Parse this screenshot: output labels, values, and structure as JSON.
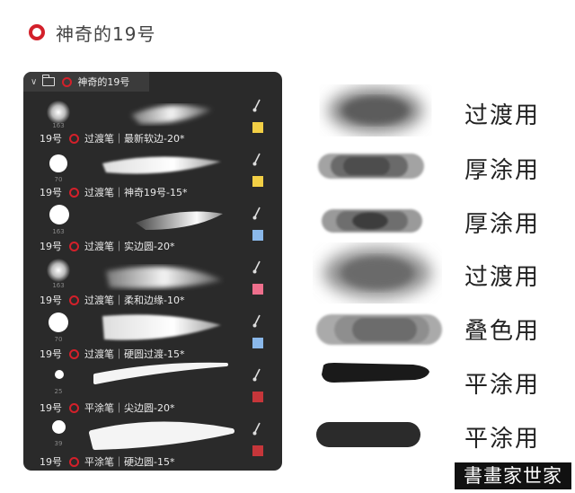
{
  "header": {
    "title": "神奇的19号"
  },
  "panel": {
    "group_name": "神奇的19号",
    "brushes": [
      {
        "size": "163",
        "tip": "soft",
        "number": "19号",
        "name": "过渡笔｜最新软边-20*",
        "swatch": "#f2cf45"
      },
      {
        "size": "70",
        "tip": "hard",
        "number": "19号",
        "name": "过渡笔｜神奇19号-15*",
        "swatch": "#f2cf45"
      },
      {
        "size": "163",
        "tip": "hard",
        "number": "19号",
        "name": "过渡笔｜实边圆-20*",
        "swatch": "#8ab8ea"
      },
      {
        "size": "163",
        "tip": "soft",
        "number": "19号",
        "name": "过渡笔｜柔和边缘-10*",
        "swatch": "#ee6f8c"
      },
      {
        "size": "70",
        "tip": "hard",
        "number": "19号",
        "name": "过渡笔｜硬圆过渡-15*",
        "swatch": "#8ab8ea"
      },
      {
        "size": "25",
        "tip": "hard",
        "number": "19号",
        "name": "平涂笔｜尖边圆-20*",
        "swatch": "#c6363a"
      },
      {
        "size": "39",
        "tip": "hard",
        "number": "19号",
        "name": "平涂笔｜硬边圆-15*",
        "swatch": "#c6363a"
      }
    ]
  },
  "samples": [
    {
      "label": "过渡用"
    },
    {
      "label": "厚涂用"
    },
    {
      "label": "厚涂用"
    },
    {
      "label": "过渡用"
    },
    {
      "label": "叠色用"
    },
    {
      "label": "平涂用"
    },
    {
      "label": "平涂用"
    }
  ],
  "watermark": "書畫家世家"
}
